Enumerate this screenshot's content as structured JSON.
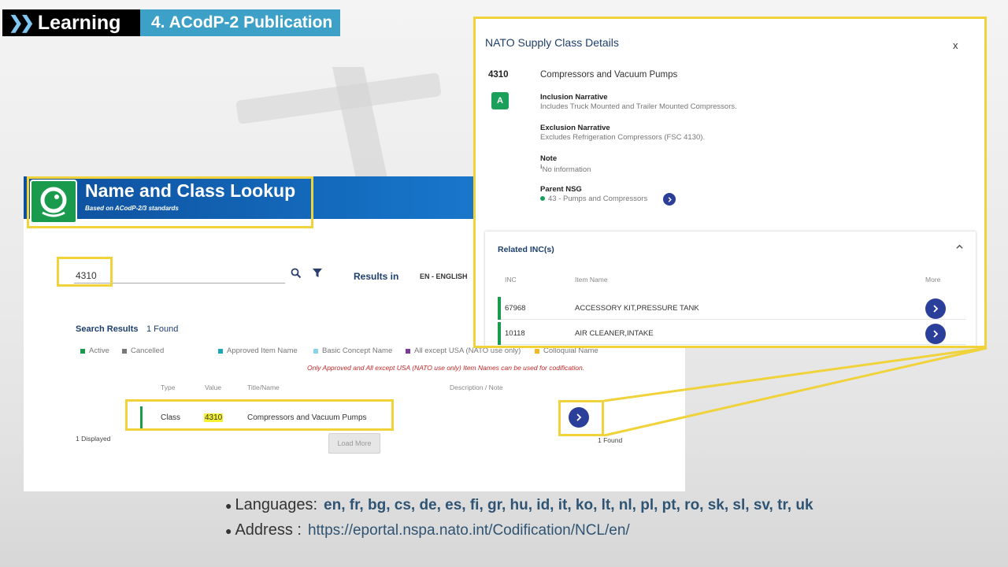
{
  "header": {
    "learning_label": "Learning",
    "publication_label": "4. ACodP-2 Publication"
  },
  "lookup": {
    "title": "Name and Class Lookup",
    "subtitle": "Based on ACodP-2/3 standards",
    "search": {
      "value": "4310"
    },
    "results_in_label": "Results in",
    "language_value": "EN - ENGLISH",
    "search_results_label": "Search Results",
    "found_count": "1 Found",
    "legend": {
      "active": "Active",
      "cancelled": "Cancelled",
      "approved_item_name": "Approved Item Name",
      "basic_concept_name": "Basic Concept Name",
      "all_except_usa": "All except USA (NATO use only)",
      "colloquial_name": "Colloquial Name"
    },
    "warning_note": "Only Approved and All except USA (NATO use only) Item Names can be used for codification.",
    "columns": {
      "type": "Type",
      "value": "Value",
      "title": "Title/Name",
      "description": "Description / Note"
    },
    "row": {
      "type": "Class",
      "value": "4310",
      "title": "Compressors and Vacuum Pumps"
    },
    "displayed": "1 Displayed",
    "load_more": "Load More",
    "found_bottom": "1 Found"
  },
  "detail": {
    "title": "NATO Supply Class Details",
    "close": "x",
    "code": "4310",
    "name": "Compressors and Vacuum Pumps",
    "status_badge": "A",
    "inclusion_label": "Inclusion Narrative",
    "inclusion_text": "Includes Truck Mounted and Trailer Mounted Compressors.",
    "exclusion_label": "Exclusion Narrative",
    "exclusion_text": "Excludes Refrigeration Compressors (FSC 4130).",
    "note_label": "Note",
    "note_text": "No information",
    "parent_label": "Parent NSG",
    "parent_text": "43 - Pumps and Compressors",
    "related": {
      "title": "Related INC(s)",
      "col_inc": "INC",
      "col_item": "Item Name",
      "col_more": "More",
      "rows": [
        {
          "inc": "67968",
          "item": "ACCESSORY KIT,PRESSURE TANK"
        },
        {
          "inc": "10118",
          "item": "AIR CLEANER,INTAKE"
        }
      ]
    }
  },
  "info": {
    "languages_label": "Languages:",
    "languages_value": "en, fr, bg, cs, de, es, fi, gr, hu, id, it, ko, lt, nl, pl, pt, ro, sk, sl, sv, tr, uk",
    "address_label": "Address :",
    "address_value": "https://eportal.nspa.nato.int/Codification/NCL/en/"
  },
  "colors": {
    "highlight": "#f0d23a",
    "active": "#1a9a4c",
    "cancelled": "#777777",
    "approved": "#1da5b8",
    "basic_concept": "#8ad4e8",
    "all_except_usa": "#7b3a9a",
    "colloquial": "#f2b822",
    "action_button": "#2b3f9a"
  }
}
